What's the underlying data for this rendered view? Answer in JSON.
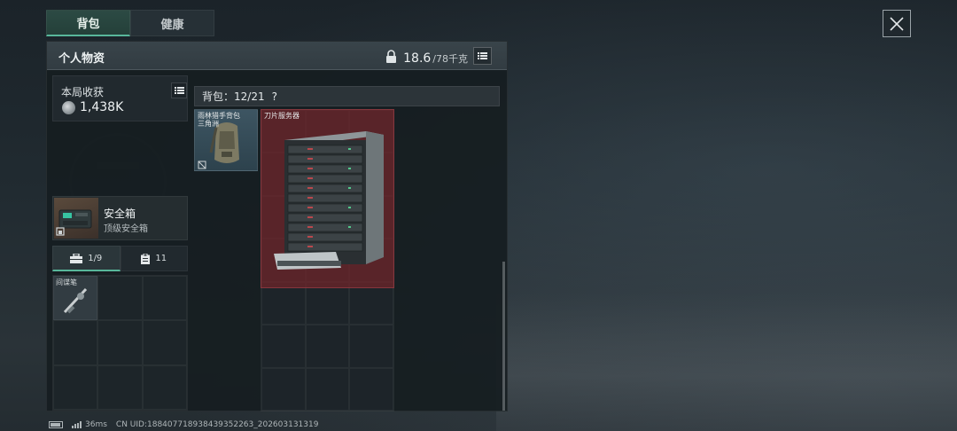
{
  "tabs": [
    {
      "label": "背包",
      "active": true
    },
    {
      "label": "健康",
      "active": false
    }
  ],
  "panel": {
    "title": "个人物资",
    "weight_current": "18.6",
    "weight_max": "/78千克"
  },
  "income": {
    "label": "本局收获",
    "value": "1,438K"
  },
  "safe_box": {
    "name": "安全箱",
    "subtitle": "顶级安全箱"
  },
  "sub_tabs": [
    {
      "label": "1/9",
      "icon": "toolbox-icon",
      "active": true
    },
    {
      "label": "11",
      "icon": "clipboard-icon",
      "active": false
    }
  ],
  "pouch_items": [
    {
      "label": "间谍笔"
    }
  ],
  "backpack": {
    "label": "背包：12/21",
    "help": "?",
    "items": [
      {
        "label": "雨林猎手背包\n三角洲"
      },
      {
        "label": "刀片服务器"
      }
    ]
  },
  "status_bar": {
    "ping": "36ms",
    "uid": "CN UID:188407718938439352263_202603131319"
  },
  "colors": {
    "accent": "#58b79a",
    "server_highlight": "#70242a"
  }
}
